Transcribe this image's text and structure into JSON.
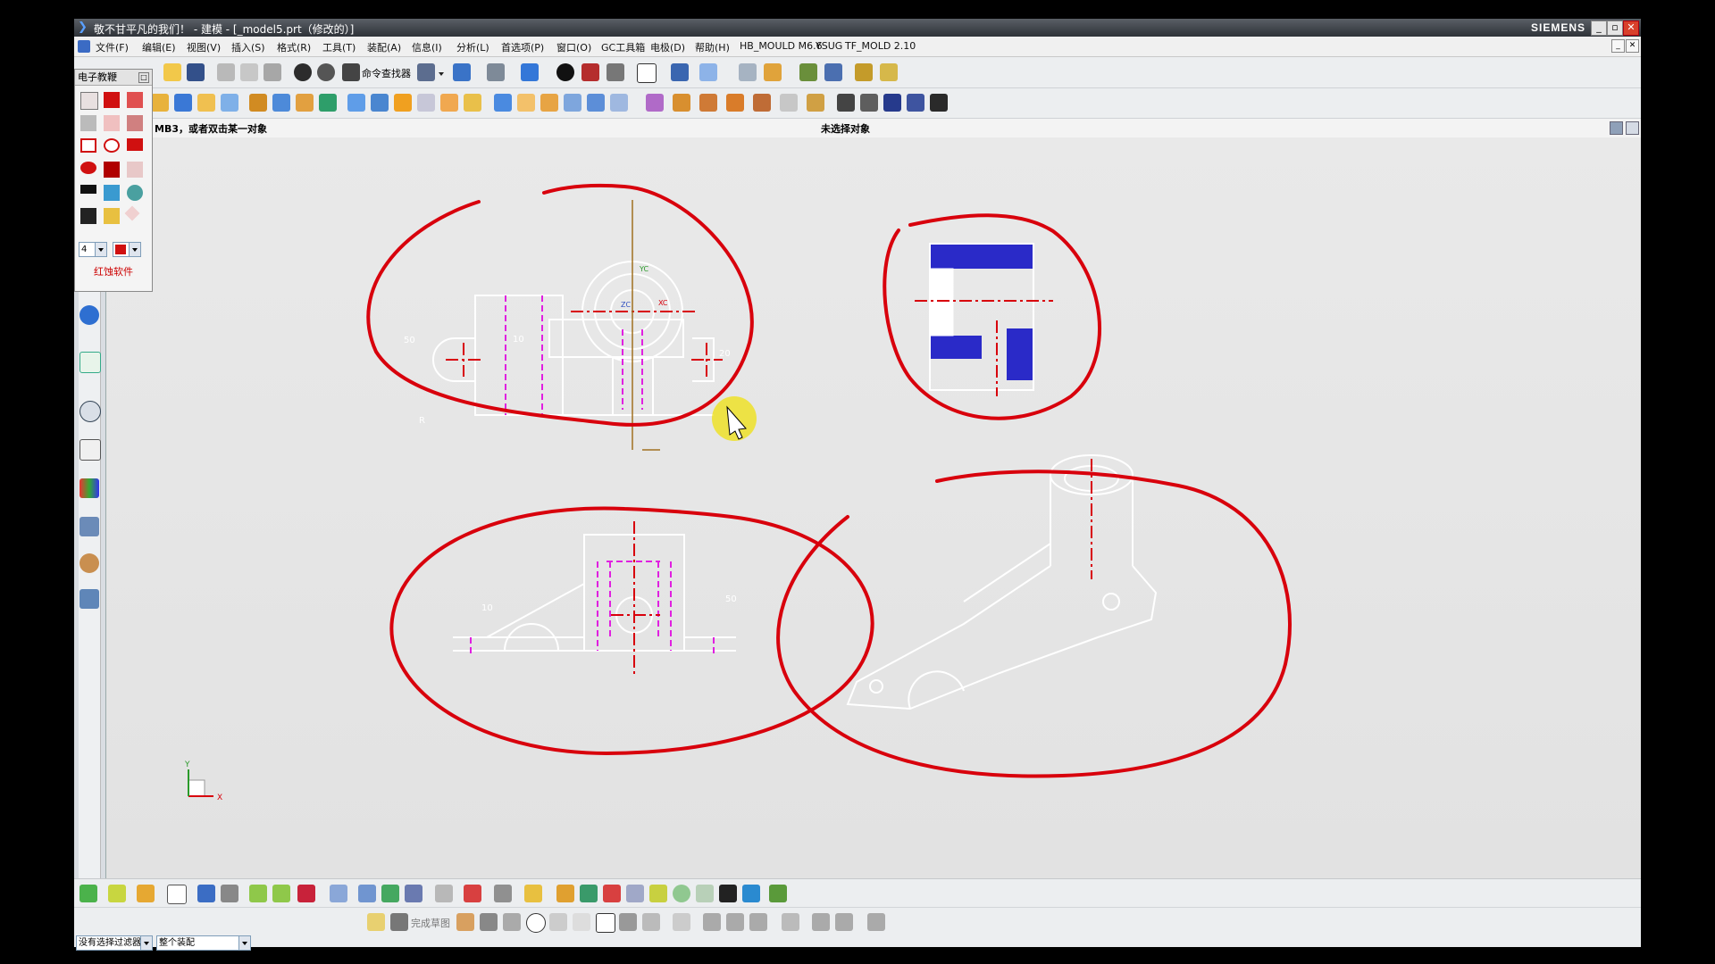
{
  "titlebar": {
    "title": "敬不甘平凡的我们！ - 建模 - [_model5.prt（修改的）]",
    "brand": "SIEMENS",
    "min": "_",
    "max": "▫",
    "close": "✕"
  },
  "menubar": {
    "items": [
      "文件(F)",
      "编辑(E)",
      "视图(V)",
      "插入(S)",
      "格式(R)",
      "工具(T)",
      "装配(A)",
      "信息(I)",
      "分析(L)",
      "首选项(P)",
      "窗口(O)",
      "GC工具箱",
      "电极(D)",
      "帮助(H)",
      "HB_MOULD M6.6",
      "YSUG",
      "TF_MOLD 2.10"
    ],
    "mdi_min": "_",
    "mdi_close": "✕"
  },
  "toolbar": {
    "command_finder": "命令查找器"
  },
  "cue_line": {
    "prompt": "MB3，或者双击某一对象",
    "status": "未选择对象"
  },
  "ebook_panel": {
    "title": "电子教鞭",
    "pin": "□",
    "width_value": "4",
    "footer": "红蚀软件"
  },
  "selection_bar": {
    "filter": "没有选择过滤器",
    "scope": "整个装配"
  },
  "sketch_bar": {
    "finish": "完成草图"
  },
  "drawing": {
    "dims": [
      "10",
      "50",
      "20",
      "R",
      "10",
      "10",
      "50"
    ],
    "triad_x": "X",
    "triad_y": "Y",
    "axis_xc": "XC",
    "axis_yc": "YC",
    "axis_zc": "ZC"
  },
  "colors": {
    "annotation": "#d8000c",
    "hidden_line": "#e020e0",
    "hatch": "#2a2ac8",
    "cursor_highlight": "#f0e000"
  }
}
